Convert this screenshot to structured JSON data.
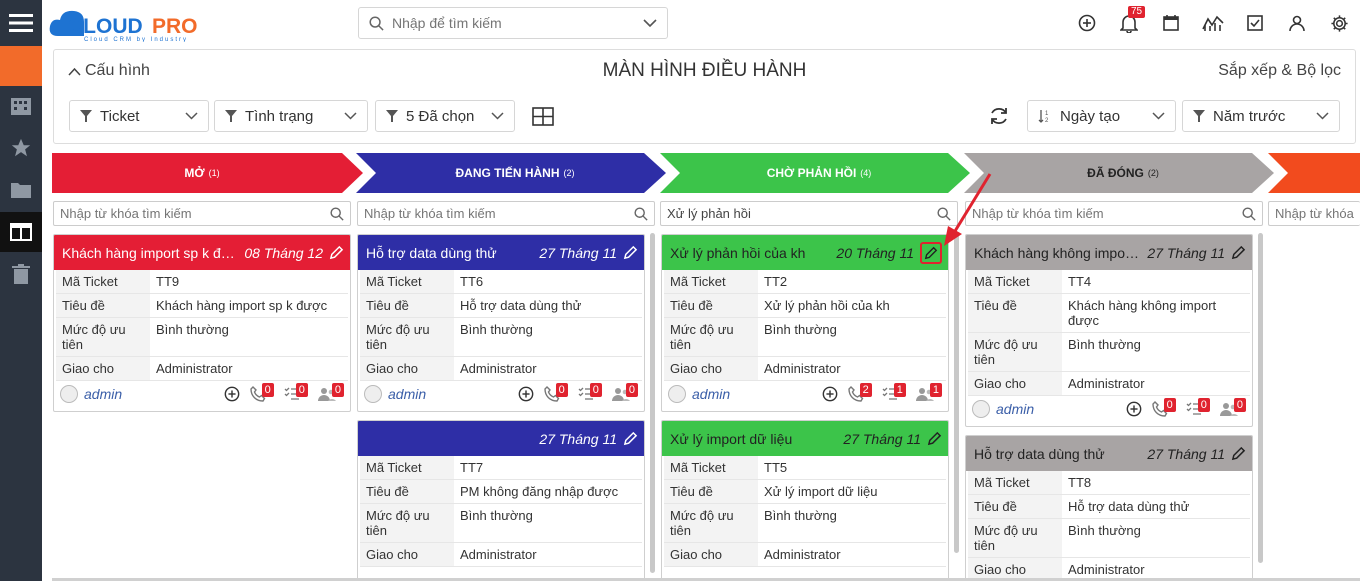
{
  "colors": {
    "red": "#e41e35",
    "blue": "#2e2ea6",
    "green": "#3cc44a",
    "gray": "#a8a4a4",
    "orange": "#f24b1e",
    "sidebar": "#2c3440",
    "accent": "#f26b2a"
  },
  "logo": {
    "brand_text": "CLOUDPRO",
    "tagline": "Cloud CRM by Industry"
  },
  "search": {
    "placeholder": "Nhập để tìm kiếm"
  },
  "notifications": {
    "count": "75"
  },
  "panel": {
    "config": "Cấu hình",
    "title": "MÀN HÌNH ĐIỀU HÀNH",
    "sort_filter": "Sắp xếp & Bộ lọc"
  },
  "filters": {
    "ticket": "Ticket",
    "status": "Tình trạng",
    "selected": "5 Đã chọn",
    "sort": "Ngày tạo",
    "period": "Năm trước"
  },
  "stages": [
    {
      "name": "MỞ",
      "count": "(1)"
    },
    {
      "name": "ĐANG TIẾN HÀNH",
      "count": "(2)"
    },
    {
      "name": "CHỜ PHẢN HỒI",
      "count": "(4)"
    },
    {
      "name": "ĐÃ ĐÓNG",
      "count": "(2)"
    }
  ],
  "column_search": {
    "placeholder": "Nhập từ khóa tìm kiếm",
    "green_value": "Xử lý phản hồi"
  },
  "labels": {
    "code": "Mã Ticket",
    "subject": "Tiêu đề",
    "priority": "Mức độ ưu tiên",
    "assignee": "Giao cho"
  },
  "cards": [
    {
      "title": "Khách hàng import sp k đư...",
      "date": "08 Tháng 12",
      "code": "TT9",
      "subject": "Khách hàng import sp k được",
      "priority": "Bình thường",
      "assignee": "Administrator",
      "user": "admin",
      "calls": "0",
      "tasks": "0",
      "people": "0"
    },
    {
      "title": "Hỗ trợ data dùng thử",
      "date": "27 Tháng 11",
      "code": "TT6",
      "subject": "Hỗ trợ data dùng thử",
      "priority": "Bình thường",
      "assignee": "Administrator",
      "user": "admin",
      "calls": "0",
      "tasks": "0",
      "people": "0"
    },
    {
      "title": "",
      "date": "27 Tháng 11",
      "code": "TT7",
      "subject": "PM không đăng nhập được",
      "priority": "Bình thường",
      "assignee": "Administrator"
    },
    {
      "title": "Xử lý phản hồi của kh",
      "date": "20 Tháng 11",
      "code": "TT2",
      "subject": "Xử lý phản hồi của kh",
      "priority": "Bình thường",
      "assignee": "Administrator",
      "user": "admin",
      "calls": "2",
      "tasks": "1",
      "people": "1"
    },
    {
      "title": "Xử lý import dữ liệu",
      "date": "27 Tháng 11",
      "code": "TT5",
      "subject": "Xử lý import dữ liệu",
      "priority": "Bình thường",
      "assignee": "Administrator"
    },
    {
      "title": "Khách hàng không import...",
      "date": "27 Tháng 11",
      "code": "TT4",
      "subject": "Khách hàng không import được",
      "priority": "Bình thường",
      "assignee": "Administrator",
      "user": "admin",
      "calls": "0",
      "tasks": "0",
      "people": "0"
    },
    {
      "title": "Hỗ trợ data dùng thử",
      "date": "27 Tháng 11",
      "code": "TT8",
      "subject": "Hỗ trợ data dùng thử",
      "priority": "Bình thường",
      "assignee": "Administrator"
    }
  ]
}
